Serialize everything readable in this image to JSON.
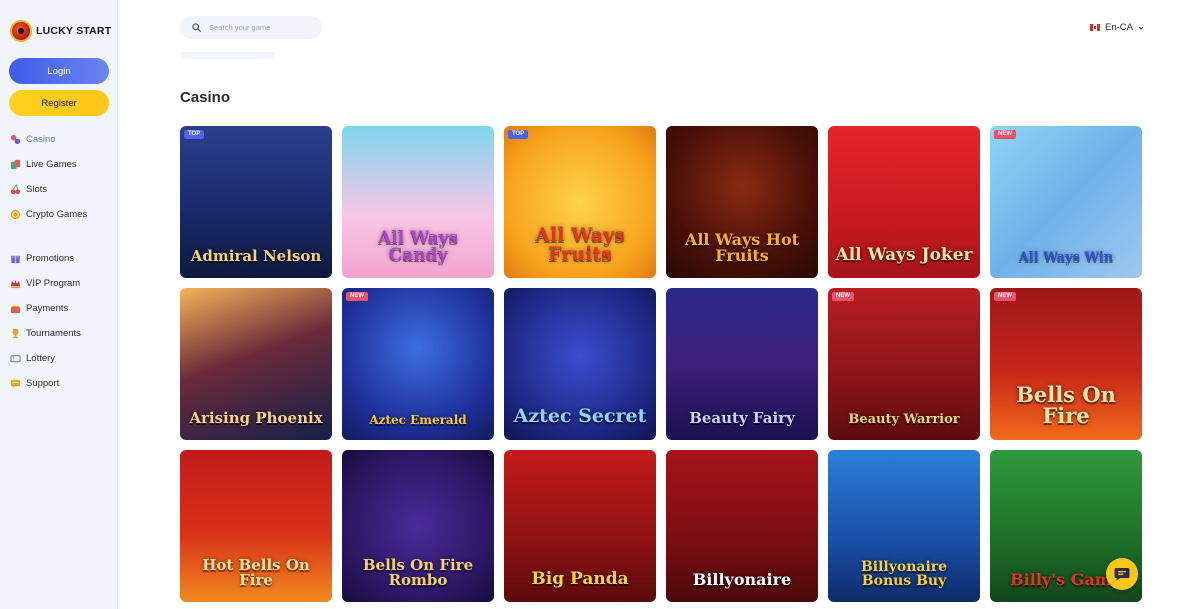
{
  "brand": {
    "name": "LUCKY START"
  },
  "auth": {
    "login_label": "Login",
    "register_label": "Register"
  },
  "nav_main": [
    {
      "label": "Casino",
      "icon": "casino-icon",
      "color": "#e5526a"
    },
    {
      "label": "Live Games",
      "icon": "cards-icon",
      "color": "#3db07a"
    },
    {
      "label": "Slots",
      "icon": "cherry-icon",
      "color": "#e0443c"
    },
    {
      "label": "Crypto Games",
      "icon": "coin-icon",
      "color": "#e7a51b"
    }
  ],
  "nav_secondary": [
    {
      "label": "Promotions",
      "icon": "gift-icon",
      "color": "#6a5fd8"
    },
    {
      "label": "VIP Program",
      "icon": "crown-icon",
      "color": "#c63a5a"
    },
    {
      "label": "Payments",
      "icon": "wallet-icon",
      "color": "#e05b52"
    },
    {
      "label": "Tournaments",
      "icon": "trophy-icon",
      "color": "#e7a51b"
    },
    {
      "label": "Lottery",
      "icon": "ticket-icon",
      "color": "#6b7a9c"
    },
    {
      "label": "Support",
      "icon": "support-icon",
      "color": "#e7a51b"
    }
  ],
  "search": {
    "placeholder": "Search your game"
  },
  "language": {
    "label": "En-CA"
  },
  "section": {
    "title": "Casino"
  },
  "games": [
    {
      "name": "Admiral Nelson",
      "badge": "TOP",
      "bg": "linear-gradient(180deg,#2b3f8c 0%,#1a2a6b 55%,#0d1a3f 100%)",
      "color": "#f4d27a",
      "size": 15
    },
    {
      "name": "All Ways Candy",
      "badge": "",
      "bg": "linear-gradient(180deg,#7fd6f0 0%,#f9c6e4 60%,#f2a3d0 100%)",
      "color": "#b43ed0",
      "size": 17
    },
    {
      "name": "All Ways Fruits",
      "badge": "TOP",
      "bg": "radial-gradient(circle at 50% 50%,#ffd34a 0%,#f7a21c 70%,#e07a10 100%)",
      "color": "#e8321e",
      "size": 19
    },
    {
      "name": "All Ways Hot Fruits",
      "badge": "",
      "bg": "radial-gradient(circle at 50% 40%,#8a2a12 0%,#4a1008 60%,#2a0804 100%)",
      "color": "#ffb01f",
      "size": 16
    },
    {
      "name": "All Ways Joker",
      "badge": "",
      "bg": "linear-gradient(180deg,#e5252a 0%,#c71a20 60%,#a5141a 100%)",
      "color": "#ffe8a8",
      "size": 17
    },
    {
      "name": "All Ways Win",
      "badge": "NEW",
      "bg": "linear-gradient(135deg,#8fd5f4 0%,#6fb2ea 50%,#9fc8f0 100%)",
      "color": "#2f4fd8",
      "size": 13
    },
    {
      "name": "Arising Phoenix",
      "badge": "",
      "bg": "linear-gradient(160deg,#f6b35a 0%,#6a2a3a 45%,#16204a 100%)",
      "color": "#f7d48a",
      "size": 15
    },
    {
      "name": "Aztec Emerald",
      "badge": "NEW",
      "bg": "radial-gradient(circle at 50% 40%,#3d6ee0 0%,#1e2f9a 65%,#121c5c 100%)",
      "color": "#f6c93a",
      "size": 12
    },
    {
      "name": "Aztec Secret",
      "badge": "",
      "bg": "radial-gradient(circle at 50% 45%,#3a4fd0 0%,#1c2580 70%,#0f1550 100%)",
      "color": "#8fd4ff",
      "size": 19
    },
    {
      "name": "Beauty Fairy",
      "badge": "",
      "bg": "linear-gradient(180deg,#2a2a8a 0%,#3f1f7a 50%,#1a1050 100%)",
      "color": "#c9d2ff",
      "size": 15
    },
    {
      "name": "Beauty Warrior",
      "badge": "NEW",
      "bg": "linear-gradient(180deg,#b81e22 0%,#8a1418 60%,#5c0c0e 100%)",
      "color": "#f2d86a",
      "size": 13
    },
    {
      "name": "Bells On Fire",
      "badge": "NEW",
      "bg": "linear-gradient(180deg,#9e1818 0%,#c8261a 55%,#f26a1a 100%)",
      "color": "#f6e2a4",
      "size": 21
    },
    {
      "name": "Hot Bells On Fire",
      "badge": "",
      "bg": "linear-gradient(180deg,#c21a1a 0%,#d83218 55%,#f28a1e 100%)",
      "color": "#ffe0a0",
      "size": 15
    },
    {
      "name": "Bells On Fire Rombo",
      "badge": "",
      "bg": "radial-gradient(circle at 50% 50%,#4a2a9a 0%,#2a1660 70%,#170c3a 100%)",
      "color": "#f6d36a",
      "size": 15
    },
    {
      "name": "Big Panda",
      "badge": "",
      "bg": "linear-gradient(180deg,#c41a1a 0%,#8e1212 60%,#5c0a0a 100%)",
      "color": "#ffd24a",
      "size": 17
    },
    {
      "name": "Billyonaire",
      "badge": "",
      "bg": "linear-gradient(180deg,#a5141a 0%,#7a0e12 60%,#4a080a 100%)",
      "color": "#ffffff",
      "size": 16
    },
    {
      "name": "Billyonaire Bonus Buy",
      "badge": "",
      "bg": "linear-gradient(180deg,#2a7fd8 0%,#1a4fa8 60%,#0f2a6a 100%)",
      "color": "#f6d03a",
      "size": 14
    },
    {
      "name": "Billy's Game",
      "badge": "",
      "bg": "linear-gradient(180deg,#2e9a3a 0%,#1e6e28 60%,#12461a 100%)",
      "color": "#e8321e",
      "size": 16
    }
  ]
}
